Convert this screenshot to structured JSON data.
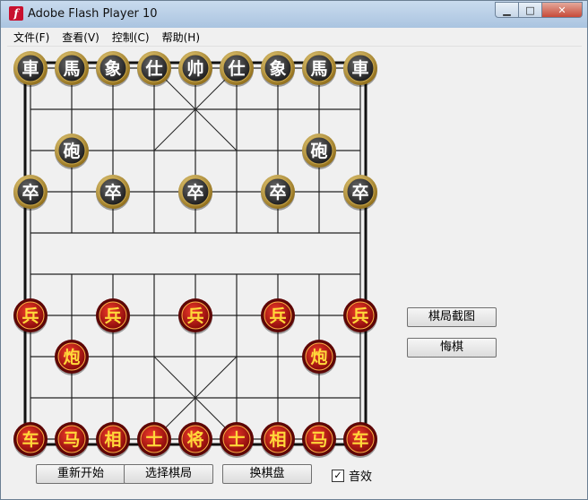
{
  "window": {
    "title": "Adobe Flash Player 10",
    "app_icon": "flash-icon"
  },
  "caption_buttons": {
    "minimize": "▭",
    "maximize": "□",
    "close": "✕"
  },
  "menu": [
    "文件(F)",
    "查看(V)",
    "控制(C)",
    "帮助(H)"
  ],
  "side_buttons": {
    "screenshot": "棋局截图",
    "undo": "悔棋"
  },
  "bottom_buttons": {
    "restart": "重新开始",
    "select_game": "选择棋局",
    "change_board": "换棋盘"
  },
  "sound": {
    "label": "音效",
    "checked": true
  },
  "colors": {
    "black_piece_text": "#ffffff",
    "red_piece_text": "#ffd83a",
    "black_piece": "#3a3a3a",
    "red_piece": "#c01414",
    "piece_rim": "#b8962e"
  },
  "pieces": [
    {
      "label": "車",
      "side": "black",
      "file": 0,
      "rank": 0
    },
    {
      "label": "馬",
      "side": "black",
      "file": 1,
      "rank": 0
    },
    {
      "label": "象",
      "side": "black",
      "file": 2,
      "rank": 0
    },
    {
      "label": "仕",
      "side": "black",
      "file": 3,
      "rank": 0
    },
    {
      "label": "帅",
      "side": "black",
      "file": 4,
      "rank": 0
    },
    {
      "label": "仕",
      "side": "black",
      "file": 5,
      "rank": 0
    },
    {
      "label": "象",
      "side": "black",
      "file": 6,
      "rank": 0
    },
    {
      "label": "馬",
      "side": "black",
      "file": 7,
      "rank": 0
    },
    {
      "label": "車",
      "side": "black",
      "file": 8,
      "rank": 0
    },
    {
      "label": "砲",
      "side": "black",
      "file": 1,
      "rank": 2
    },
    {
      "label": "砲",
      "side": "black",
      "file": 7,
      "rank": 2
    },
    {
      "label": "卒",
      "side": "black",
      "file": 0,
      "rank": 3
    },
    {
      "label": "卒",
      "side": "black",
      "file": 2,
      "rank": 3
    },
    {
      "label": "卒",
      "side": "black",
      "file": 4,
      "rank": 3
    },
    {
      "label": "卒",
      "side": "black",
      "file": 6,
      "rank": 3
    },
    {
      "label": "卒",
      "side": "black",
      "file": 8,
      "rank": 3
    },
    {
      "label": "兵",
      "side": "red",
      "file": 0,
      "rank": 6
    },
    {
      "label": "兵",
      "side": "red",
      "file": 2,
      "rank": 6
    },
    {
      "label": "兵",
      "side": "red",
      "file": 4,
      "rank": 6
    },
    {
      "label": "兵",
      "side": "red",
      "file": 6,
      "rank": 6
    },
    {
      "label": "兵",
      "side": "red",
      "file": 8,
      "rank": 6
    },
    {
      "label": "炮",
      "side": "red",
      "file": 1,
      "rank": 7
    },
    {
      "label": "炮",
      "side": "red",
      "file": 7,
      "rank": 7
    },
    {
      "label": "车",
      "side": "red",
      "file": 0,
      "rank": 9
    },
    {
      "label": "马",
      "side": "red",
      "file": 1,
      "rank": 9
    },
    {
      "label": "相",
      "side": "red",
      "file": 2,
      "rank": 9
    },
    {
      "label": "士",
      "side": "red",
      "file": 3,
      "rank": 9
    },
    {
      "label": "将",
      "side": "red",
      "file": 4,
      "rank": 9
    },
    {
      "label": "士",
      "side": "red",
      "file": 5,
      "rank": 9
    },
    {
      "label": "相",
      "side": "red",
      "file": 6,
      "rank": 9
    },
    {
      "label": "马",
      "side": "red",
      "file": 7,
      "rank": 9
    },
    {
      "label": "车",
      "side": "red",
      "file": 8,
      "rank": 9
    }
  ]
}
